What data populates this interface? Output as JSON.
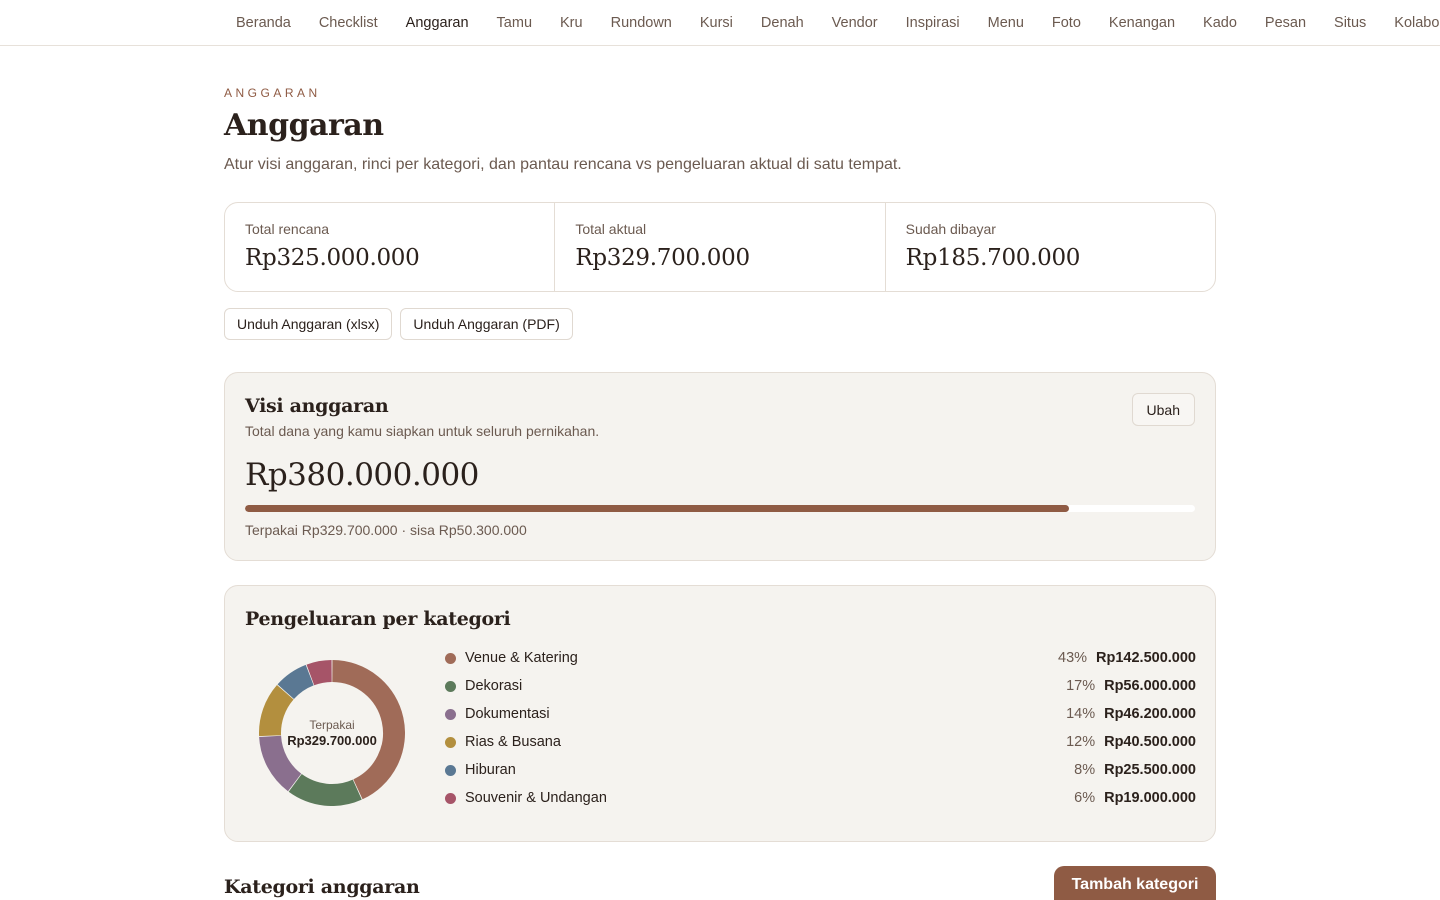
{
  "nav": {
    "items": [
      "Beranda",
      "Checklist",
      "Anggaran",
      "Tamu",
      "Kru",
      "Rundown",
      "Kursi",
      "Denah",
      "Vendor",
      "Inspirasi",
      "Menu",
      "Foto",
      "Kenangan",
      "Kado",
      "Pesan",
      "Situs",
      "Kolaborasi"
    ],
    "active": "Anggaran"
  },
  "header": {
    "eyebrow": "ANGGARAN",
    "title": "Anggaran",
    "subtitle": "Atur visi anggaran, rinci per kategori, dan pantau rencana vs pengeluaran aktual di satu tempat."
  },
  "summary": {
    "planned_label": "Total rencana",
    "planned_value": "Rp325.000.000",
    "actual_label": "Total aktual",
    "actual_value": "Rp329.700.000",
    "paid_label": "Sudah dibayar",
    "paid_value": "Rp185.700.000"
  },
  "downloads": {
    "xlsx_label": "Unduh Anggaran (xlsx)",
    "pdf_label": "Unduh Anggaran (PDF)"
  },
  "vision": {
    "title": "Visi anggaran",
    "description": "Total dana yang kamu siapkan untuk seluruh pernikahan.",
    "edit_label": "Ubah",
    "amount": "Rp380.000.000",
    "used_fraction": 0.8676,
    "used_text": "Terpakai Rp329.700.000 · sisa Rp50.300.000"
  },
  "categories": {
    "title": "Pengeluaran per kategori",
    "donut_label": "Terpakai",
    "donut_value": "Rp329.700.000",
    "items": [
      {
        "name": "Venue & Katering",
        "pct": "43%",
        "amount": "Rp142.500.000",
        "value": 142500000,
        "color": "#a06b58"
      },
      {
        "name": "Dekorasi",
        "pct": "17%",
        "amount": "Rp56.000.000",
        "value": 56000000,
        "color": "#5c7a5b"
      },
      {
        "name": "Dokumentasi",
        "pct": "14%",
        "amount": "Rp46.200.000",
        "value": 46200000,
        "color": "#8a6f8e"
      },
      {
        "name": "Rias & Busana",
        "pct": "12%",
        "amount": "Rp40.500.000",
        "value": 40500000,
        "color": "#b38f3e"
      },
      {
        "name": "Hiburan",
        "pct": "8%",
        "amount": "Rp25.500.000",
        "value": 25500000,
        "color": "#5a7893"
      },
      {
        "name": "Souvenir & Undangan",
        "pct": "6%",
        "amount": "Rp19.000.000",
        "value": 19000000,
        "color": "#a65468"
      }
    ]
  },
  "budget_section": {
    "title": "Kategori anggaran",
    "add_label": "Tambah kategori"
  }
}
